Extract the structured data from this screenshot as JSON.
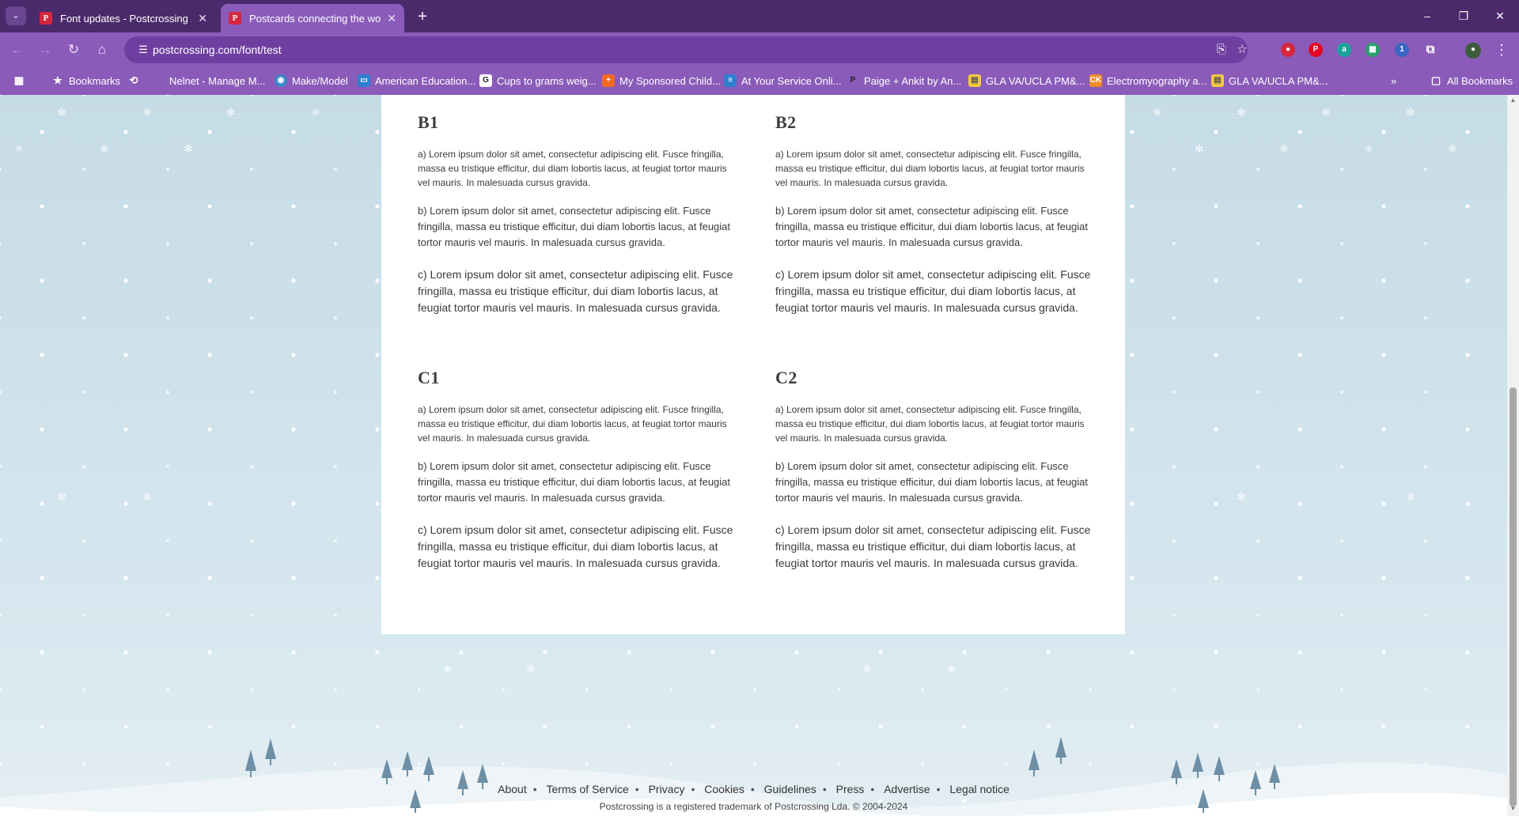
{
  "browser": {
    "tabs": [
      {
        "title": "Font updates - Postcrossing / B",
        "favicon": "P"
      },
      {
        "title": "Postcards connecting the world",
        "favicon": "P"
      }
    ],
    "new_tab_icon": "plus-icon",
    "url": "postcrossing.com/font/test",
    "bookmarks": [
      {
        "label": "Bookmarks",
        "icon": "star-icon"
      },
      {
        "label": "Nelnet - Manage M...",
        "icon": "nelnet-favicon"
      },
      {
        "label": "Make/Model",
        "icon": "globe-favicon"
      },
      {
        "label": "American Education...",
        "icon": "aes-favicon"
      },
      {
        "label": "Cups to grams weig...",
        "icon": "cg-favicon"
      },
      {
        "label": "My Sponsored Child...",
        "icon": "sponsor-favicon"
      },
      {
        "label": "At Your Service Onli...",
        "icon": "service-favicon"
      },
      {
        "label": "Paige + Ankit by An...",
        "icon": "p-favicon"
      },
      {
        "label": "GLA VA/UCLA PM&...",
        "icon": "doc-favicon"
      },
      {
        "label": "Electromyography a...",
        "icon": "ck-favicon"
      },
      {
        "label": "GLA VA/UCLA PM&...",
        "icon": "doc-favicon"
      }
    ],
    "all_bookmarks": "All Bookmarks"
  },
  "sections": [
    {
      "heading": "B1",
      "a": "a) Lorem ipsum dolor sit amet, consectetur adipiscing elit. Fusce fringilla, massa eu tristique efficitur, dui diam lobortis lacus, at feugiat tortor mauris vel mauris. In malesuada cursus gravida.",
      "b": "b) Lorem ipsum dolor sit amet, consectetur adipiscing elit. Fusce fringilla, massa eu tristique efficitur, dui diam lobortis lacus, at feugiat tortor mauris vel mauris. In malesuada cursus gravida.",
      "c": "c) Lorem ipsum dolor sit amet, consectetur adipiscing elit. Fusce fringilla, massa eu tristique efficitur, dui diam lobortis lacus, at feugiat tortor mauris vel mauris. In malesuada cursus gravida."
    },
    {
      "heading": "B2",
      "a": "a) Lorem ipsum dolor sit amet, consectetur adipiscing elit. Fusce fringilla, massa eu tristique efficitur, dui diam lobortis lacus, at feugiat tortor mauris vel mauris. In malesuada cursus gravida.",
      "b": "b) Lorem ipsum dolor sit amet, consectetur adipiscing elit. Fusce fringilla, massa eu tristique efficitur, dui diam lobortis lacus, at feugiat tortor mauris vel mauris. In malesuada cursus gravida.",
      "c": "c) Lorem ipsum dolor sit amet, consectetur adipiscing elit. Fusce fringilla, massa eu tristique efficitur, dui diam lobortis lacus, at feugiat tortor mauris vel mauris. In malesuada cursus gravida."
    },
    {
      "heading": "C1",
      "a": "a) Lorem ipsum dolor sit amet, consectetur adipiscing elit. Fusce fringilla, massa eu tristique efficitur, dui diam lobortis lacus, at feugiat tortor mauris vel mauris. In malesuada cursus gravida.",
      "b": "b) Lorem ipsum dolor sit amet, consectetur adipiscing elit. Fusce fringilla, massa eu tristique efficitur, dui diam lobortis lacus, at feugiat tortor mauris vel mauris. In malesuada cursus gravida.",
      "c": "c) Lorem ipsum dolor sit amet, consectetur adipiscing elit. Fusce fringilla, massa eu tristique efficitur, dui diam lobortis lacus, at feugiat tortor mauris vel mauris. In malesuada cursus gravida."
    },
    {
      "heading": "C2",
      "a": "a) Lorem ipsum dolor sit amet, consectetur adipiscing elit. Fusce fringilla, massa eu tristique efficitur, dui diam lobortis lacus, at feugiat tortor mauris vel mauris. In malesuada cursus gravida.",
      "b": "b) Lorem ipsum dolor sit amet, consectetur adipiscing elit. Fusce fringilla, massa eu tristique efficitur, dui diam lobortis lacus, at feugiat tortor mauris vel mauris. In malesuada cursus gravida.",
      "c": "c) Lorem ipsum dolor sit amet, consectetur adipiscing elit. Fusce fringilla, massa eu tristique efficitur, dui diam lobortis lacus, at feugiat tortor mauris vel mauris. In malesuada cursus gravida."
    }
  ],
  "footer": {
    "links": [
      "About",
      "Terms of Service",
      "Privacy",
      "Cookies",
      "Guidelines",
      "Press",
      "Advertise",
      "Legal notice"
    ],
    "note": "Postcrossing is a registered trademark of Postcrossing Lda. © 2004-2024"
  },
  "colors": {
    "tab_bar": "#4b2a6b",
    "toolbar": "#8a5bb9",
    "omnibox": "#6e3fa0",
    "sky": "#c9dfe8",
    "tree": "#6e8fa6"
  }
}
